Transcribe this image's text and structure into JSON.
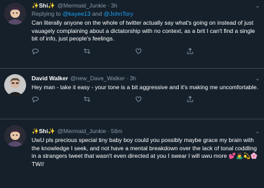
{
  "tweets": [
    {
      "name": "✨Shi✨",
      "handle": "@Mermaid_Junkie",
      "separator": "·",
      "time": "3h",
      "reply_prefix": "Replying to",
      "reply_mentions": [
        "@kayee13",
        "@JohnTory"
      ],
      "reply_joiner": "and",
      "text": "Can literally anyone on the whole of twitter actually say what's going on instead of just vauagely complaining about a dictatorship with no context, as a brit I can't find a single bit of info, just people's feelings.",
      "avatar": "cartoon-avatar"
    },
    {
      "name": "David Walker",
      "handle": "@new_Dave_Walker",
      "separator": "·",
      "time": "3h",
      "text": "Hey man - take it easy - your tone is a bit aggressive and it's making me uncomfortable.",
      "avatar": "photo-avatar"
    },
    {
      "name": "✨Shi✨",
      "handle": "@Mermaid_Junkie",
      "separator": "·",
      "time": "56m",
      "text": "UwU pls precious special tiny baby boy could you possibly maybe grace my brain with the knowledge I seek, and not have a mental breakdown over the lack of tonal coddling in a strangers tweet that wasn't even directed at you I swear I will uwu more 💕🙇‍♂️💫🌸 TW//",
      "avatar": "cartoon-avatar"
    }
  ],
  "icons": [
    "reply-icon",
    "retweet-icon",
    "like-icon",
    "share-icon",
    "more-caret-icon"
  ],
  "colors": {
    "background": "#15202b",
    "border": "#38444d",
    "secondary_text": "#8899a6",
    "link": "#1da1f2"
  }
}
